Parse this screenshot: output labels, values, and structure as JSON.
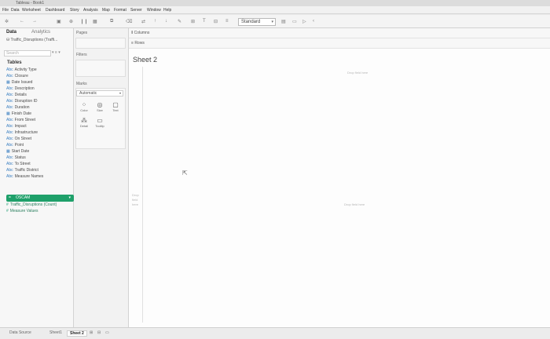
{
  "window": {
    "title": "Tableau - Book1"
  },
  "menu": [
    "File",
    "Data",
    "Worksheet",
    "Dashboard",
    "Story",
    "Analysis",
    "Map",
    "Format",
    "Server",
    "Window",
    "Help"
  ],
  "toolbar": {
    "fit_value": "Standard"
  },
  "left_pane": {
    "tabs": [
      "Data",
      "Analytics"
    ],
    "datasource": "Traffic_Disruptions (Traffi...",
    "search_placeholder": "Search",
    "tables_header": "Tables",
    "dimensions": [
      "Activity Type",
      "Closure",
      "Date Issued",
      "Description",
      "Details",
      "Disruption ID",
      "Duration",
      "Finish Date",
      "From Street",
      "Impact",
      "Infrastructure",
      "On Street",
      "Point",
      "Start Date",
      "Status",
      "To Street",
      "Traffic District"
    ],
    "measures_before": [
      "Measure Names"
    ],
    "selected_field": "OSCAM",
    "measures_after": [
      "Traffic_Disruptions (Count)",
      "Measure Values"
    ]
  },
  "mid_pane": {
    "pages_label": "Pages",
    "filters_label": "Filters",
    "marks_label": "Marks",
    "mark_type": "Automatic",
    "mark_buttons": [
      {
        "label": "Color",
        "icon": "color-icon"
      },
      {
        "label": "Size",
        "icon": "size-icon"
      },
      {
        "label": "Text",
        "icon": "text-icon"
      },
      {
        "label": "Detail",
        "icon": "detail-icon"
      },
      {
        "label": "Tooltip",
        "icon": "tooltip-icon"
      }
    ]
  },
  "shelves": {
    "columns_label": "Columns",
    "rows_label": "Rows"
  },
  "canvas": {
    "sheet_title": "Sheet 2",
    "drop_field_top": "Drop field here",
    "drop_field_right": "Drop field here",
    "drop_field_left": "Drop field here"
  },
  "status_bar": {
    "datasource_tab": "Data Source",
    "sheet_tabs": [
      "Sheet1",
      "Sheet 2"
    ]
  }
}
